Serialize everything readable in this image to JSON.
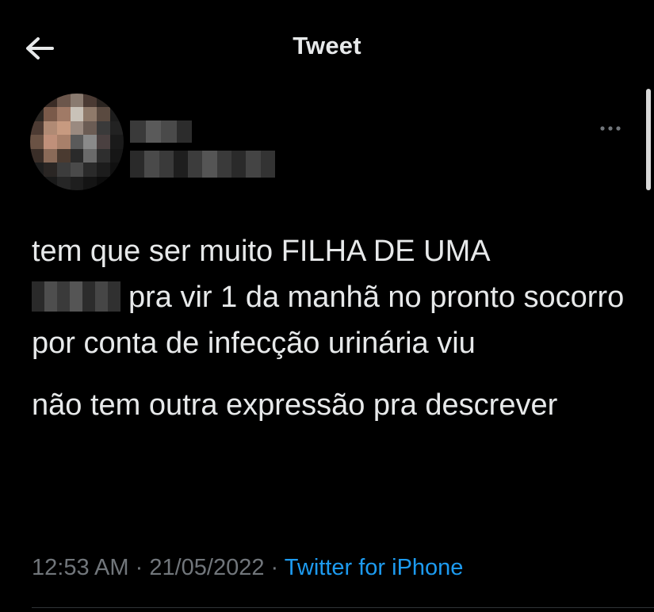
{
  "header": {
    "title": "Tweet",
    "back_icon": "arrow-left-icon"
  },
  "author": {
    "avatar_blurred": true,
    "name_blurred": true,
    "handle_blurred": true,
    "more_icon": "more-horizontal-icon"
  },
  "tweet": {
    "line1": "tem que ser muito FILHA DE UMA",
    "line2_after_redaction": "pra vir 1 da manhã no pronto socorro por conta de infecção urinária viu",
    "paragraph2": "não tem outra expressão pra descrever"
  },
  "meta": {
    "time": "12:53 AM",
    "separator": "·",
    "date": "21/05/2022",
    "source": "Twitter for iPhone"
  },
  "colors": {
    "background": "#000000",
    "text": "#e7e9ea",
    "muted": "#71767b",
    "link": "#1d9bf0"
  }
}
